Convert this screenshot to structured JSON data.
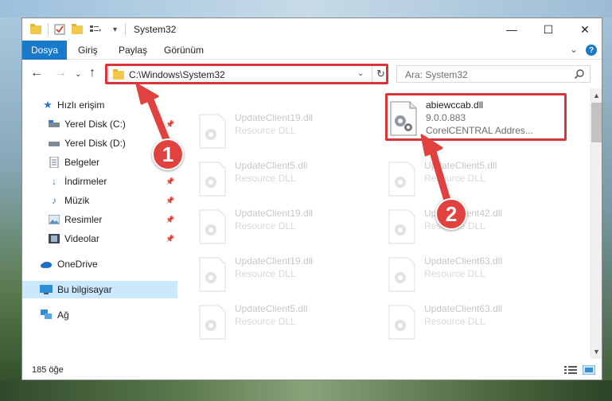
{
  "window": {
    "title": "System32",
    "controls": {
      "minimize": "—",
      "maximize": "☐",
      "close": "✕"
    }
  },
  "ribbon": {
    "tabs": [
      "Dosya",
      "Giriş",
      "Paylaş",
      "Görünüm"
    ],
    "help": "?"
  },
  "nav": {
    "address": "C:\\Windows\\System32",
    "search_placeholder": "Ara: System32"
  },
  "sidebar": {
    "items": [
      {
        "label": "Hızlı erişim",
        "icon": "star-icon",
        "pinned": false
      },
      {
        "label": "Yerel Disk (C:)",
        "icon": "drive-icon",
        "pinned": true
      },
      {
        "label": "Yerel Disk (D:)",
        "icon": "drive-icon",
        "pinned": true
      },
      {
        "label": "Belgeler",
        "icon": "documents-icon",
        "pinned": true
      },
      {
        "label": "İndirmeler",
        "icon": "download-icon",
        "pinned": true
      },
      {
        "label": "Müzik",
        "icon": "music-icon",
        "pinned": true
      },
      {
        "label": "Resimler",
        "icon": "pictures-icon",
        "pinned": true
      },
      {
        "label": "Videolar",
        "icon": "video-icon",
        "pinned": true
      },
      {
        "label": "OneDrive",
        "icon": "cloud-icon",
        "pinned": false
      },
      {
        "label": "Bu bilgisayar",
        "icon": "computer-icon",
        "pinned": false,
        "selected": true
      },
      {
        "label": "Ağ",
        "icon": "network-icon",
        "pinned": false
      }
    ]
  },
  "files": {
    "highlighted": {
      "name": "abiewccab.dll",
      "version": "9.0.0.883",
      "company": "CorelCENTRAL Addres..."
    },
    "background": [
      {
        "name": "UpdateClient19.dll",
        "desc": "Resource DLL"
      },
      {
        "name": "UpdateClient5.dll",
        "desc": "Resource DLL"
      },
      {
        "name": "UpdateClient5.dll",
        "desc": "Resource DLL"
      },
      {
        "name": "UpdateClient19.dll",
        "desc": "Resource DLL"
      },
      {
        "name": "UpdateClient42.dll",
        "desc": "Resource DLL"
      },
      {
        "name": "UpdateClient19.dll",
        "desc": "Resource DLL"
      },
      {
        "name": "UpdateClient63.dll",
        "desc": "Resource DLL"
      },
      {
        "name": "UpdateClient5.dll",
        "desc": "Resource DLL"
      },
      {
        "name": "UpdateClient63.dll",
        "desc": "Resource DLL"
      }
    ]
  },
  "status": {
    "count": "185 öğe"
  },
  "callouts": {
    "one": "1",
    "two": "2"
  },
  "colors": {
    "accent": "#1979ca",
    "highlight": "#d8343a",
    "selected": "#cce8ff"
  }
}
